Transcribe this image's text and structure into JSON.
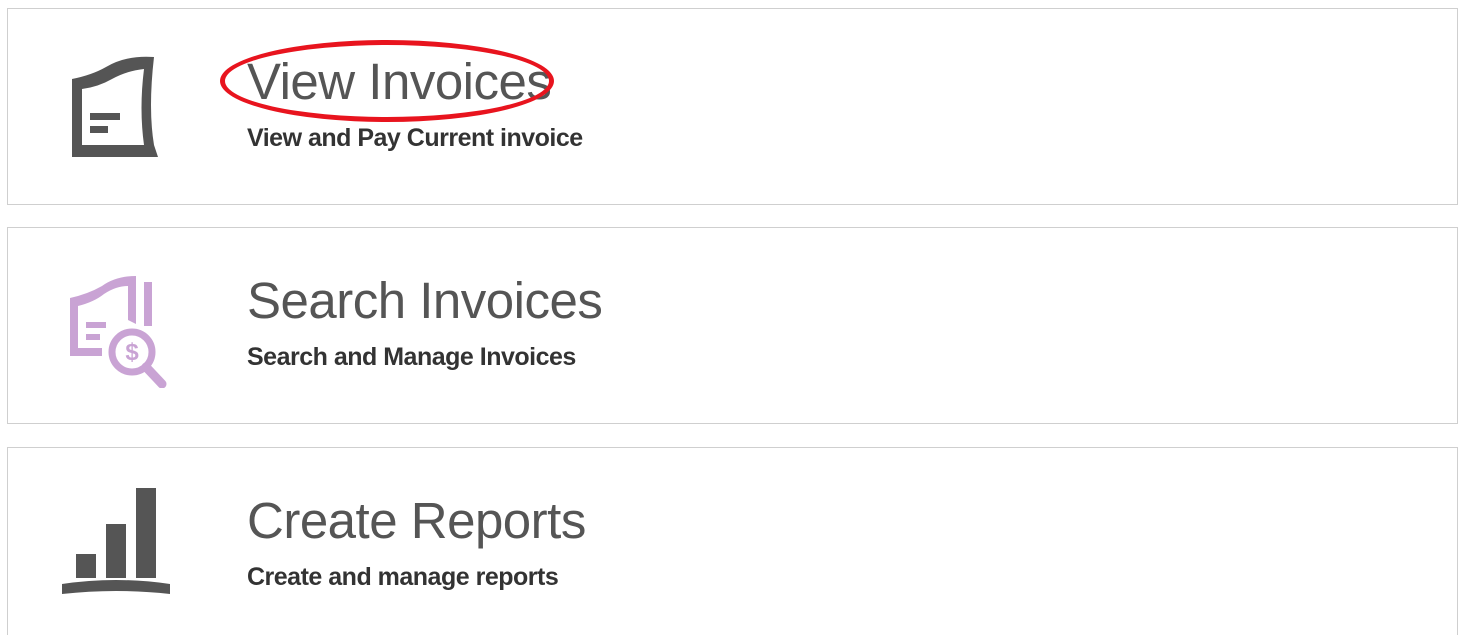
{
  "cards": [
    {
      "title": "View Invoices",
      "subtitle": "View and Pay Current invoice",
      "icon": "invoice-document-icon",
      "icon_color": "#555555"
    },
    {
      "title": "Search Invoices",
      "subtitle": "Search and Manage Invoices",
      "icon": "search-invoice-dollar-icon",
      "icon_color": "#c9a3d4"
    },
    {
      "title": "Create Reports",
      "subtitle": "Create and manage reports",
      "icon": "bar-chart-icon",
      "icon_color": "#555555"
    }
  ],
  "highlight_color": "#e8141e"
}
